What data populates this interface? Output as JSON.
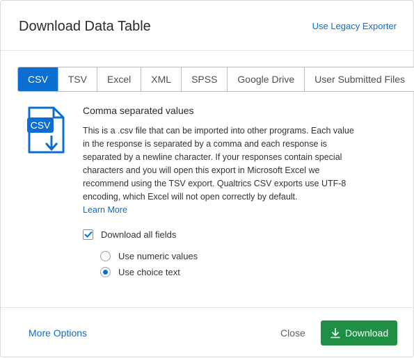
{
  "dialog": {
    "title": "Download Data Table",
    "legacy_link": "Use Legacy Exporter"
  },
  "tabs": [
    {
      "label": "CSV",
      "active": true
    },
    {
      "label": "TSV",
      "active": false
    },
    {
      "label": "Excel",
      "active": false
    },
    {
      "label": "XML",
      "active": false
    },
    {
      "label": "SPSS",
      "active": false
    },
    {
      "label": "Google Drive",
      "active": false
    },
    {
      "label": "User Submitted Files",
      "active": false
    }
  ],
  "format": {
    "icon": "csv-file-download-icon",
    "icon_text": "CSV",
    "subtitle": "Comma separated values",
    "description_lines": [
      "This is a .csv file that can be imported into other programs. Each value",
      "in the response is separated by a comma and each response is",
      "separated by a newline character. If your responses contain special",
      "characters and you will open this export in Microsoft Excel we",
      "recommend using the TSV export. Qualtrics CSV exports use UTF-8",
      "encoding, which Excel will not open correctly by default."
    ],
    "learn_more": "Learn More"
  },
  "options": {
    "download_all_fields": {
      "label": "Download all fields",
      "checked": true
    },
    "value_mode": [
      {
        "label": "Use numeric values",
        "selected": false
      },
      {
        "label": "Use choice text",
        "selected": true
      }
    ]
  },
  "footer": {
    "more_options": "More Options",
    "close": "Close",
    "download": "Download"
  },
  "colors": {
    "accent": "#0b6ed0",
    "download_green": "#1f8f44"
  }
}
